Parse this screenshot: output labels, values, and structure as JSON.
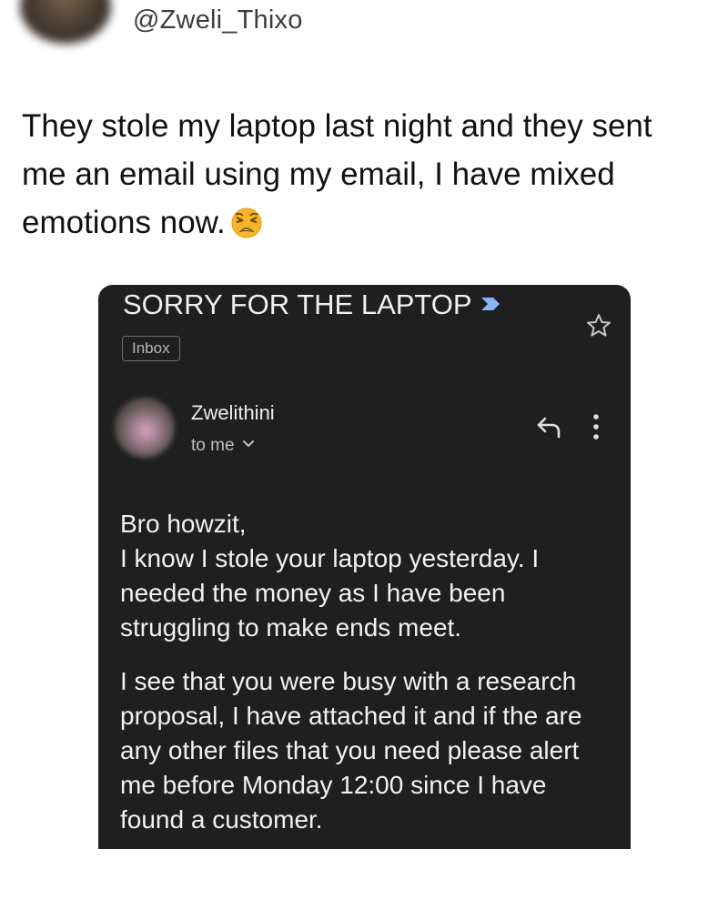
{
  "tweet": {
    "handle": "@Zweli_Thixo",
    "text": "They stole my laptop last night and they sent me an email using my email, I have mixed emotions now.",
    "emoji": "weary-face"
  },
  "email": {
    "subject": "SORRY FOR THE LAPTOP",
    "label": "Inbox",
    "sender": "Zwelithini",
    "recipient": "to me",
    "body": {
      "greeting": "Bro howzit,",
      "paragraph1": "I know I stole your laptop yesterday. I needed the money as I have been struggling to make ends meet.",
      "paragraph2": "I see that you were busy with a research proposal, I have attached it and if the are any other files that you need please alert me before Monday 12:00 since I have found a customer."
    },
    "icons": {
      "important": "important-marker-icon",
      "star": "star-icon",
      "reply": "reply-icon",
      "more": "more-vertical-icon",
      "chevron": "chevron-down-icon"
    }
  },
  "colors": {
    "card_background": "#1f1f1f",
    "important_marker": "#8ab4f8",
    "emoji_face": "#f7b52c"
  }
}
